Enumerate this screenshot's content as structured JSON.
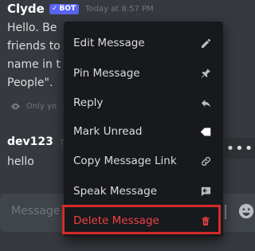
{
  "message1": {
    "author": "Clyde",
    "bot_badge": "BOT",
    "timestamp": "Today at 8:57 PM",
    "lines": [
      "Hello. Be",
      "friends to",
      "name in t",
      "People\"."
    ],
    "ephemeral_note": "Only yo"
  },
  "message2": {
    "author": "dev123",
    "timestamp": "T",
    "text": "hello"
  },
  "more_button": "•••",
  "input": {
    "placeholder": "Message"
  },
  "menu": {
    "items": [
      {
        "label": "Edit Message",
        "icon": "pencil-icon"
      },
      {
        "label": "Pin Message",
        "icon": "pin-icon"
      },
      {
        "label": "Reply",
        "icon": "reply-icon"
      },
      {
        "label": "Mark Unread",
        "icon": "flag-icon"
      },
      {
        "label": "Copy Message Link",
        "icon": "link-icon"
      },
      {
        "label": "Speak Message",
        "icon": "speak-icon"
      },
      {
        "label": "Delete Message",
        "icon": "trash-icon",
        "danger": true
      }
    ]
  },
  "colors": {
    "background": "#36393f",
    "menu_bg": "#18191c",
    "blurple": "#5865f2",
    "danger": "#ed4245",
    "highlight": "#d42a2a"
  }
}
